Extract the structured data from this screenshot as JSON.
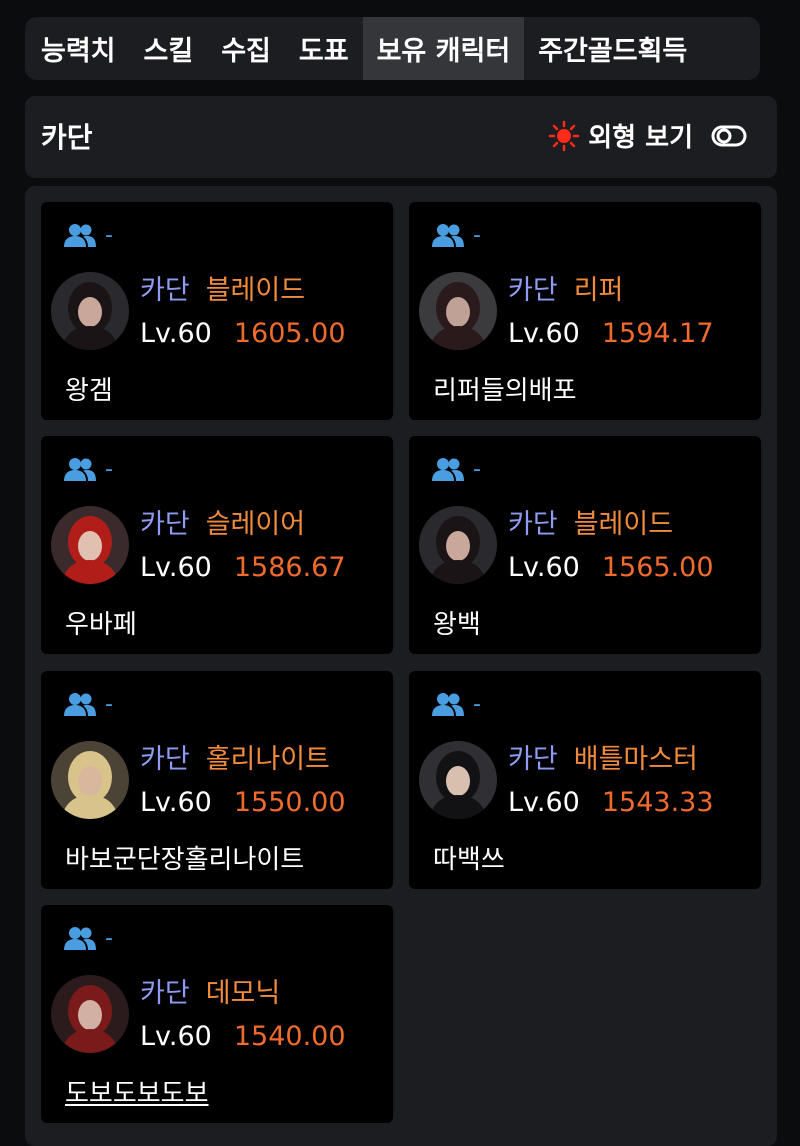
{
  "tabs": [
    {
      "label": "능력치",
      "active": false
    },
    {
      "label": "스킬",
      "active": false
    },
    {
      "label": "수집",
      "active": false
    },
    {
      "label": "도표",
      "active": false
    },
    {
      "label": "보유 캐릭터",
      "active": true
    },
    {
      "label": "주간골드획득",
      "active": false
    }
  ],
  "header": {
    "title": "카단",
    "appearance_label": "외형 보기",
    "appearance_icon": "sun-icon",
    "toggle_icon": "toggle-icon",
    "accent_color": "#ff2a1a"
  },
  "colors": {
    "class_group": "#8e9bf0",
    "class_name": "#f08b3c",
    "item_level": "#f06b2c",
    "party_icon": "#4a9de0"
  },
  "characters": [
    {
      "party": "-",
      "server": "카단",
      "class": "블레이드",
      "level": "Lv.60",
      "item_level": "1605.00",
      "name": "왕겜",
      "underline": false,
      "avatar_icon": "blade-portrait"
    },
    {
      "party": "-",
      "server": "카단",
      "class": "리퍼",
      "level": "Lv.60",
      "item_level": "1594.17",
      "name": "리퍼들의배포",
      "underline": false,
      "avatar_icon": "reaper-portrait"
    },
    {
      "party": "-",
      "server": "카단",
      "class": "슬레이어",
      "level": "Lv.60",
      "item_level": "1586.67",
      "name": "우바페",
      "underline": false,
      "avatar_icon": "slayer-portrait"
    },
    {
      "party": "-",
      "server": "카단",
      "class": "블레이드",
      "level": "Lv.60",
      "item_level": "1565.00",
      "name": "왕백",
      "underline": false,
      "avatar_icon": "blade-portrait"
    },
    {
      "party": "-",
      "server": "카단",
      "class": "홀리나이트",
      "level": "Lv.60",
      "item_level": "1550.00",
      "name": "바보군단장홀리나이트",
      "underline": false,
      "avatar_icon": "holyknight-portrait"
    },
    {
      "party": "-",
      "server": "카단",
      "class": "배틀마스터",
      "level": "Lv.60",
      "item_level": "1543.33",
      "name": "따백쓰",
      "underline": false,
      "avatar_icon": "battlemaster-portrait"
    },
    {
      "party": "-",
      "server": "카단",
      "class": "데모닉",
      "level": "Lv.60",
      "item_level": "1540.00",
      "name": "도보도보도보",
      "underline": true,
      "avatar_icon": "demonic-portrait"
    }
  ]
}
